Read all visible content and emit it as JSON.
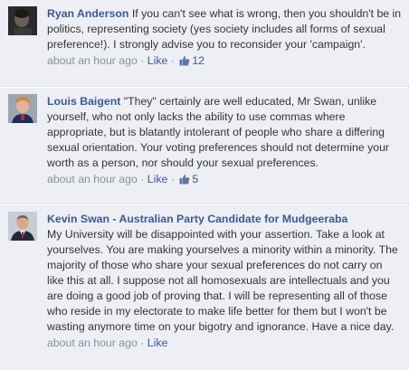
{
  "comments": [
    {
      "author": "Ryan Anderson",
      "text": " If you can't see what is wrong, then you shouldn't be in politics, representing society (yes society includes all forms of sexual preference!). I strongly advise you to reconsider your 'campaign'.",
      "time": "about an hour ago",
      "separator": "·",
      "like_label": "Like",
      "like_icon": "thumbs-up-icon",
      "like_count": "12"
    },
    {
      "author": "Louis Baigent",
      "text": " \"They\" certainly are well educated, Mr Swan, unlike yourself, who not only lacks the ability to use commas where appropriate, but is blatantly intolerant of people who share a differing sexual orientation. Your voting preferences should not determine your worth as a person, nor should your sexual preferences.",
      "time": "about an hour ago",
      "separator": "·",
      "like_label": "Like",
      "like_icon": "thumbs-up-icon",
      "like_count": "5"
    },
    {
      "author": "Kevin Swan - Australian Party Candidate for Mudgeeraba",
      "text": "My University will be disappointed with your assertion. Take a look at yourselves. You are making yourselves a minority within a minority. The majority of those who share your sexual preferences do not carry on like this at all. I suppose not all homosexuals are intellectuals and you are doing a good job of proving that. I will be representing all of those who reside in my electorate to make life better for them but I won't be wasting anymore time on your bigotry and ignorance. Have a nice day.",
      "time": "about an hour ago",
      "separator": "·",
      "like_label": "Like"
    }
  ],
  "colors": {
    "comment_background": "#edeff4",
    "link_blue": "#3b5998",
    "meta_gray": "#89919c",
    "text": "#333333"
  }
}
